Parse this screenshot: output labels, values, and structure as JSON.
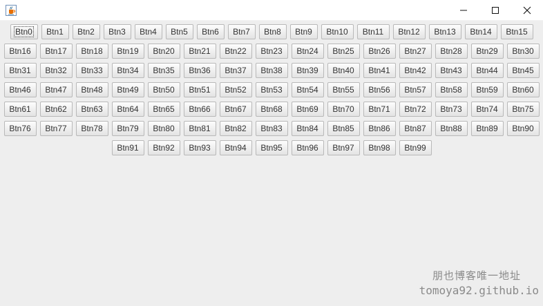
{
  "window": {
    "title": "",
    "app_icon": "java-cup-icon",
    "controls": [
      "minimize-icon",
      "maximize-icon",
      "close-icon"
    ]
  },
  "buttons": {
    "rows": [
      [
        "Btn0",
        "Btn1",
        "Btn2",
        "Btn3",
        "Btn4",
        "Btn5",
        "Btn6",
        "Btn7",
        "Btn8",
        "Btn9",
        "Btn10",
        "Btn11",
        "Btn12",
        "Btn13",
        "Btn14",
        "Btn15"
      ],
      [
        "Btn16",
        "Btn17",
        "Btn18",
        "Btn19",
        "Btn20",
        "Btn21",
        "Btn22",
        "Btn23",
        "Btn24",
        "Btn25",
        "Btn26",
        "Btn27",
        "Btn28",
        "Btn29",
        "Btn30"
      ],
      [
        "Btn31",
        "Btn32",
        "Btn33",
        "Btn34",
        "Btn35",
        "Btn36",
        "Btn37",
        "Btn38",
        "Btn39",
        "Btn40",
        "Btn41",
        "Btn42",
        "Btn43",
        "Btn44",
        "Btn45"
      ],
      [
        "Btn46",
        "Btn47",
        "Btn48",
        "Btn49",
        "Btn50",
        "Btn51",
        "Btn52",
        "Btn53",
        "Btn54",
        "Btn55",
        "Btn56",
        "Btn57",
        "Btn58",
        "Btn59",
        "Btn60"
      ],
      [
        "Btn61",
        "Btn62",
        "Btn63",
        "Btn64",
        "Btn65",
        "Btn66",
        "Btn67",
        "Btn68",
        "Btn69",
        "Btn70",
        "Btn71",
        "Btn72",
        "Btn73",
        "Btn74",
        "Btn75"
      ],
      [
        "Btn76",
        "Btn77",
        "Btn78",
        "Btn79",
        "Btn80",
        "Btn81",
        "Btn82",
        "Btn83",
        "Btn84",
        "Btn85",
        "Btn86",
        "Btn87",
        "Btn88",
        "Btn89",
        "Btn90"
      ],
      [
        "Btn91",
        "Btn92",
        "Btn93",
        "Btn94",
        "Btn95",
        "Btn96",
        "Btn97",
        "Btn98",
        "Btn99"
      ]
    ],
    "focused": "Btn0"
  },
  "watermark": {
    "line1": "朋也博客唯一地址",
    "line2": "tomoya92.github.io"
  },
  "colors": {
    "background": "#eeeeee",
    "titlebar": "#ffffff",
    "button_border": "#b8b8b8",
    "text": "#333333",
    "watermark": "#8a8a8a"
  }
}
